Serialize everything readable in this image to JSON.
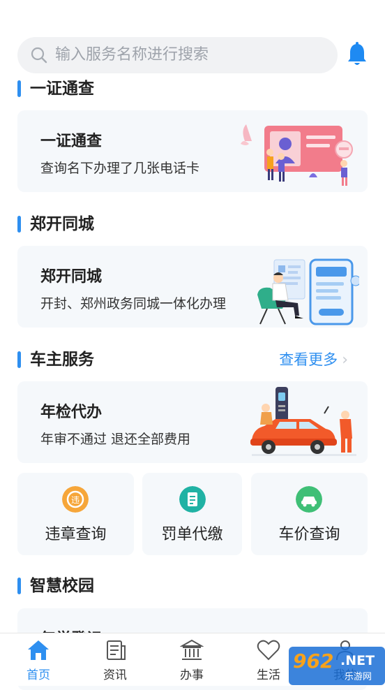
{
  "search": {
    "placeholder": "输入服务名称进行搜索"
  },
  "colors": {
    "accent": "#2e8ff0",
    "card_bg": "#f5f8fb",
    "search_bg": "#f1f2f4"
  },
  "sections": [
    {
      "title": "一证通查",
      "card": {
        "title": "一证通查",
        "subtitle": "查询名下办理了几张电话卡",
        "illustration": "id-card-people-illustration"
      }
    },
    {
      "title": "郑开同城",
      "card": {
        "title": "郑开同城",
        "subtitle": "开封、郑州政务同城一体化办理",
        "illustration": "businessman-phone-illustration"
      }
    },
    {
      "title": "车主服务",
      "more": "查看更多",
      "card": {
        "title": "年检代办",
        "subtitle": "年审不通过 退还全部费用",
        "illustration": "car-service-illustration"
      }
    },
    {
      "title": "智慧校园",
      "card": {
        "title": "复学登记"
      }
    }
  ],
  "car_services": [
    {
      "label": "违章查询",
      "icon": "violation-icon"
    },
    {
      "label": "罚单代缴",
      "icon": "ticket-icon"
    },
    {
      "label": "车价查询",
      "icon": "car-price-icon"
    }
  ],
  "tabs": [
    {
      "label": "首页",
      "icon": "home-icon",
      "active": true
    },
    {
      "label": "资讯",
      "icon": "news-icon"
    },
    {
      "label": "办事",
      "icon": "government-icon"
    },
    {
      "label": "生活",
      "icon": "heart-icon"
    },
    {
      "label": "我的",
      "icon": "user-icon"
    }
  ],
  "watermark": {
    "num": "962",
    "net": ".NET",
    "cn": "乐游网"
  }
}
